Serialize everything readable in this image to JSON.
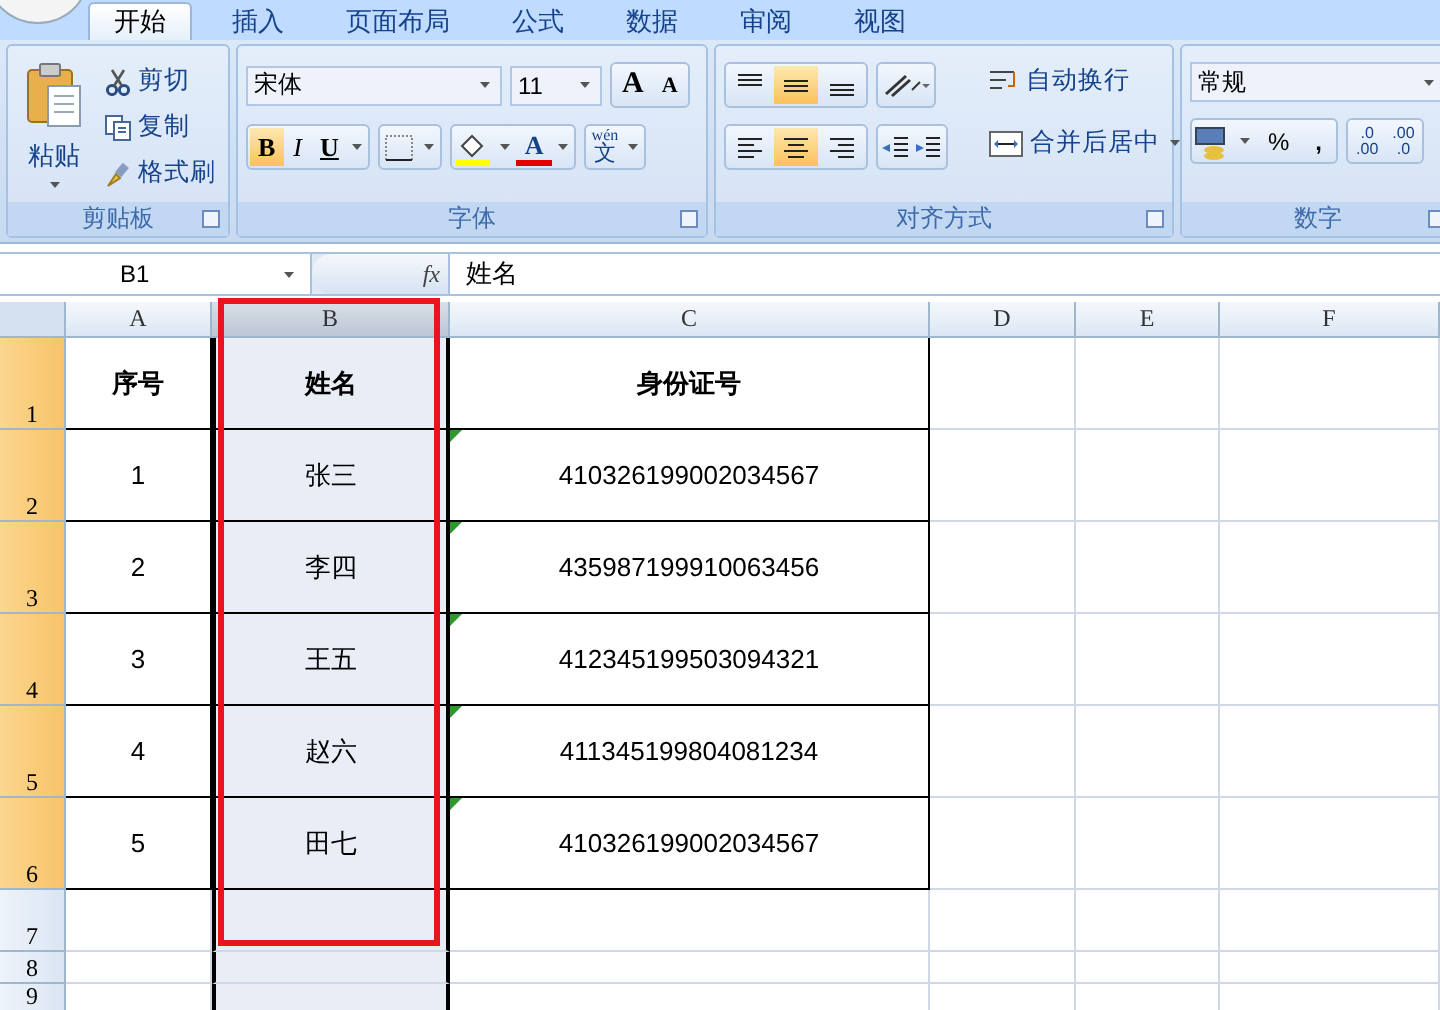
{
  "ribbon": {
    "tabs": [
      {
        "label": "开始",
        "selected": true
      },
      {
        "label": "插入",
        "selected": false
      },
      {
        "label": "页面布局",
        "selected": false
      },
      {
        "label": "公式",
        "selected": false
      },
      {
        "label": "数据",
        "selected": false
      },
      {
        "label": "审阅",
        "selected": false
      },
      {
        "label": "视图",
        "selected": false
      }
    ],
    "groups": [
      {
        "kind": "clipboard",
        "title": "剪贴板",
        "paste": "粘贴",
        "items": [
          "剪切",
          "复制",
          "格式刷"
        ]
      },
      {
        "kind": "font",
        "title": "字体",
        "font": "宋体",
        "size": "11",
        "grow": "A",
        "shrink": "A",
        "styles": [
          {
            "label": "B",
            "on": true
          },
          {
            "label": "I",
            "on": false
          },
          {
            "label": "U",
            "on": false
          }
        ],
        "font_color": "A",
        "phonetic_top": "wén",
        "phonetic": "文"
      },
      {
        "kind": "alignment",
        "title": "对齐方式",
        "vertical": [
          {
            "selected": false
          },
          {
            "selected": true
          },
          {
            "selected": false
          }
        ],
        "horizontal": [
          {
            "selected": false
          },
          {
            "selected": true
          },
          {
            "selected": false
          }
        ],
        "wrap": "自动换行",
        "merge": "合并后居中"
      },
      {
        "kind": "number",
        "title": "数字",
        "format": "常规",
        "percent": "%",
        "comma": ",",
        "increase": [
          ".0",
          ".00"
        ],
        "decrease": [
          ".00",
          ".0"
        ]
      }
    ]
  },
  "formula_bar": {
    "name_box": "B1",
    "function_label": "fx",
    "formula": "姓名"
  },
  "sheet": {
    "columns": [
      {
        "label": "A",
        "selected": false
      },
      {
        "label": "B",
        "selected": true
      },
      {
        "label": "C",
        "selected": false
      },
      {
        "label": "D",
        "selected": false
      },
      {
        "label": "E",
        "selected": false
      },
      {
        "label": "F",
        "selected": false
      }
    ],
    "rows": [
      {
        "number": "1",
        "kind": "header",
        "highlighted": true,
        "cells": [
          "序号",
          "姓名",
          "身份证号"
        ],
        "error_flag": false
      },
      {
        "number": "2",
        "kind": "data",
        "highlighted": true,
        "cells": [
          "1",
          "张三",
          "410326199002034567"
        ],
        "error_flag": true
      },
      {
        "number": "3",
        "kind": "data",
        "highlighted": true,
        "cells": [
          "2",
          "李四",
          "435987199910063456"
        ],
        "error_flag": true
      },
      {
        "number": "4",
        "kind": "data",
        "highlighted": true,
        "cells": [
          "3",
          "王五",
          "412345199503094321"
        ],
        "error_flag": true
      },
      {
        "number": "5",
        "kind": "data",
        "highlighted": true,
        "cells": [
          "4",
          "赵六",
          "411345199804081234"
        ],
        "error_flag": true
      },
      {
        "number": "6",
        "kind": "data",
        "highlighted": true,
        "cells": [
          "5",
          "田七",
          "410326199002034567"
        ],
        "error_flag": true
      },
      {
        "number": "7",
        "kind": "empty",
        "highlighted": false
      },
      {
        "number": "8",
        "kind": "empty",
        "highlighted": false
      },
      {
        "number": "9",
        "kind": "empty",
        "highlighted": false
      }
    ]
  }
}
